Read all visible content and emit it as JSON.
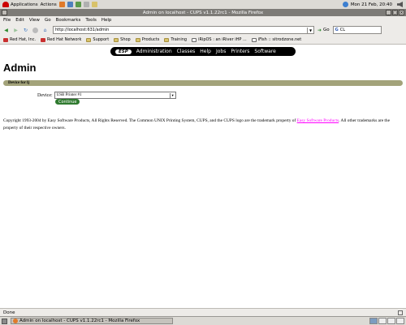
{
  "top_panel": {
    "applications_label": "Applications",
    "actions_label": "Actions",
    "clock": "Mon 21 Feb, 20:40"
  },
  "window": {
    "title": "Admin on localhost - CUPS v1.1.22rc1 - Mozilla Firefox"
  },
  "menubar": {
    "items": [
      "File",
      "Edit",
      "View",
      "Go",
      "Bookmarks",
      "Tools",
      "Help"
    ]
  },
  "navbar": {
    "url": "http://localhost:631/admin",
    "go_label": "Go",
    "search_value": "CL"
  },
  "bookmarks": {
    "items": [
      {
        "label": "Red Hat, Inc.",
        "icon": "redhat-icon"
      },
      {
        "label": "Red Hat Network",
        "icon": "redhat-icon"
      },
      {
        "label": "Support",
        "icon": "folder-icon"
      },
      {
        "label": "Shop",
        "icon": "folder-icon"
      },
      {
        "label": "Products",
        "icon": "folder-icon"
      },
      {
        "label": "Training",
        "icon": "folder-icon"
      },
      {
        "label": "iRipOS : an iRiver iHP ...",
        "icon": "page-icon"
      },
      {
        "label": "iFish :: sitrodzone.net",
        "icon": "page-icon"
      }
    ]
  },
  "cups_nav": {
    "esp_label": "ESP",
    "items": [
      "Administration",
      "Classes",
      "Help",
      "Jobs",
      "Printers",
      "Software"
    ]
  },
  "main": {
    "title": "Admin",
    "section_header": "Device for lj",
    "device_label": "Device:",
    "device_value": "USB Printer #1",
    "continue_label": "Continue",
    "copyright_text": "Copyright 1993-2004 by Easy Software Products, All Rights Reserved. The Common UNIX Printing System, CUPS, and the CUPS logo are the trademark property of ",
    "copyright_link": "Easy Software Products",
    "copyright_tail": ". All other trademarks are the property of their respective owners."
  },
  "statusbar": {
    "text": "Done"
  },
  "taskbar": {
    "task_label": "Admin on localhost - CUPS v1.1.22rc1 - Mozilla Firefox"
  }
}
